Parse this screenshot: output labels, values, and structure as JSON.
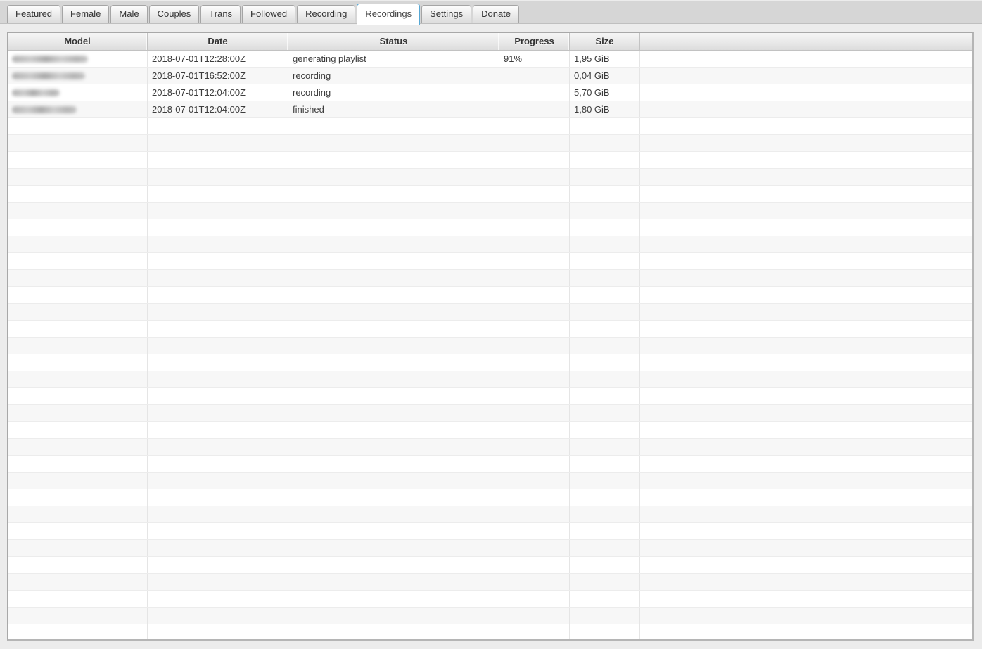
{
  "tabs": {
    "items": [
      {
        "label": "Featured",
        "active": false
      },
      {
        "label": "Female",
        "active": false
      },
      {
        "label": "Male",
        "active": false
      },
      {
        "label": "Couples",
        "active": false
      },
      {
        "label": "Trans",
        "active": false
      },
      {
        "label": "Followed",
        "active": false
      },
      {
        "label": "Recording",
        "active": false
      },
      {
        "label": "Recordings",
        "active": true
      },
      {
        "label": "Settings",
        "active": false
      },
      {
        "label": "Donate",
        "active": false
      }
    ]
  },
  "table": {
    "columns": [
      {
        "label": "Model"
      },
      {
        "label": "Date"
      },
      {
        "label": "Status"
      },
      {
        "label": "Progress"
      },
      {
        "label": "Size"
      },
      {
        "label": ""
      }
    ],
    "rows": [
      {
        "model_redacted": true,
        "redact_width": 108,
        "date": "2018-07-01T12:28:00Z",
        "status": "generating playlist",
        "progress": "91%",
        "size": "1,95 GiB"
      },
      {
        "model_redacted": true,
        "redact_width": 104,
        "date": "2018-07-01T16:52:00Z",
        "status": "recording",
        "progress": "",
        "size": "0,04 GiB"
      },
      {
        "model_redacted": true,
        "redact_width": 68,
        "date": "2018-07-01T12:04:00Z",
        "status": "recording",
        "progress": "",
        "size": "5,70 GiB"
      },
      {
        "model_redacted": true,
        "redact_width": 92,
        "date": "2018-07-01T12:04:00Z",
        "status": "finished",
        "progress": "",
        "size": "1,80 GiB"
      }
    ],
    "empty_row_count": 31
  },
  "colors": {
    "active_tab_border": "#57a8d4",
    "tabbar_background": "#d6d6d6",
    "page_background": "#ececec",
    "row_stripe": "#f7f7f7",
    "header_text": "#333333",
    "cell_text": "#3c3c3c"
  }
}
